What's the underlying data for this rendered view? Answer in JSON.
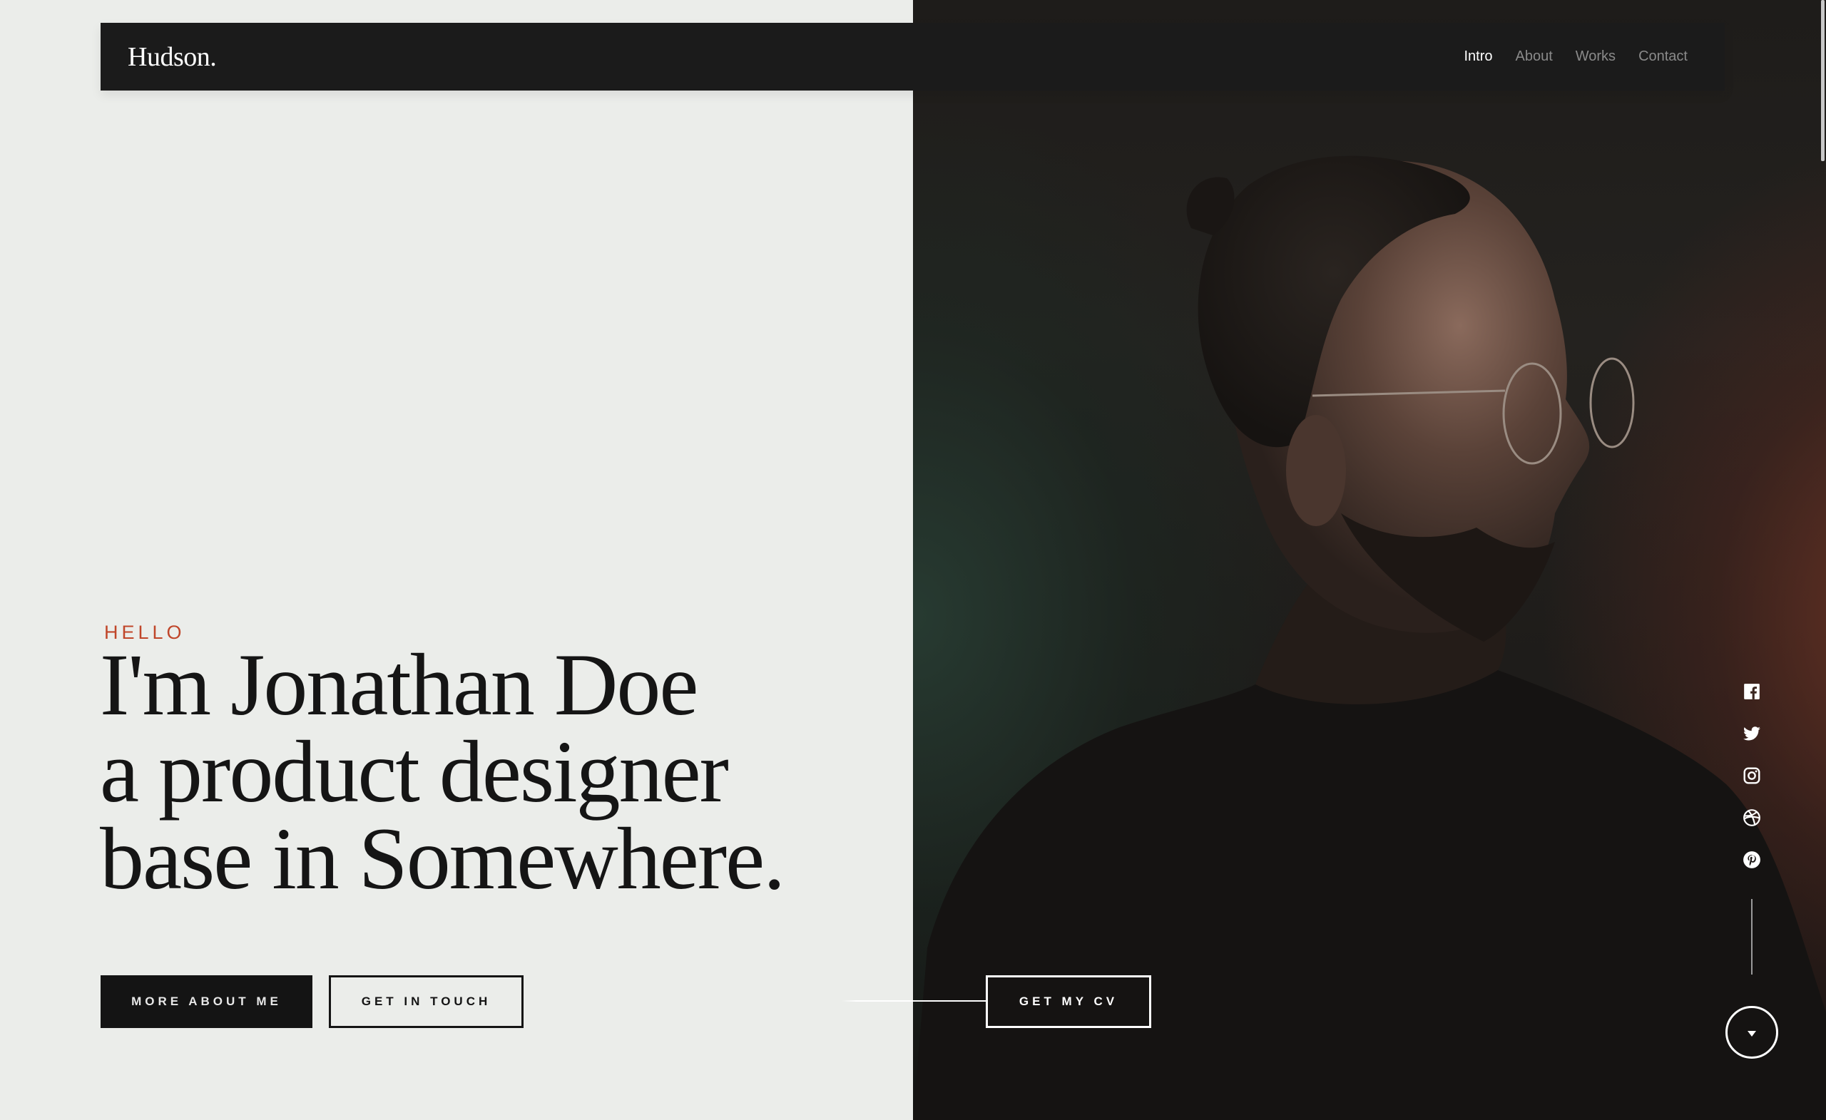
{
  "header": {
    "logo": "Hudson.",
    "nav": [
      {
        "label": "Intro",
        "active": true
      },
      {
        "label": "About",
        "active": false
      },
      {
        "label": "Works",
        "active": false
      },
      {
        "label": "Contact",
        "active": false
      }
    ]
  },
  "hero": {
    "eyebrow": "HELLO",
    "headline_lines": [
      "I'm Jonathan Doe",
      "a product designer",
      "base in Somewhere."
    ],
    "buttons": {
      "more_about": "MORE ABOUT ME",
      "get_in_touch": "GET IN TOUCH",
      "get_cv": "GET MY CV"
    }
  },
  "photo": {
    "alt": "Portrait of a man with glasses in profile against a dark green-to-rust background"
  },
  "social": [
    {
      "name": "facebook",
      "icon": "facebook-icon"
    },
    {
      "name": "twitter",
      "icon": "twitter-icon"
    },
    {
      "name": "instagram",
      "icon": "instagram-icon"
    },
    {
      "name": "dribbble",
      "icon": "dribbble-icon"
    },
    {
      "name": "pinterest",
      "icon": "pinterest-icon"
    }
  ],
  "colors": {
    "accent": "#c0462a",
    "dark": "#141414",
    "light_bg": "#ebedea",
    "header_bg": "#1b1b1b",
    "nav_inactive": "#8a8a8a"
  }
}
